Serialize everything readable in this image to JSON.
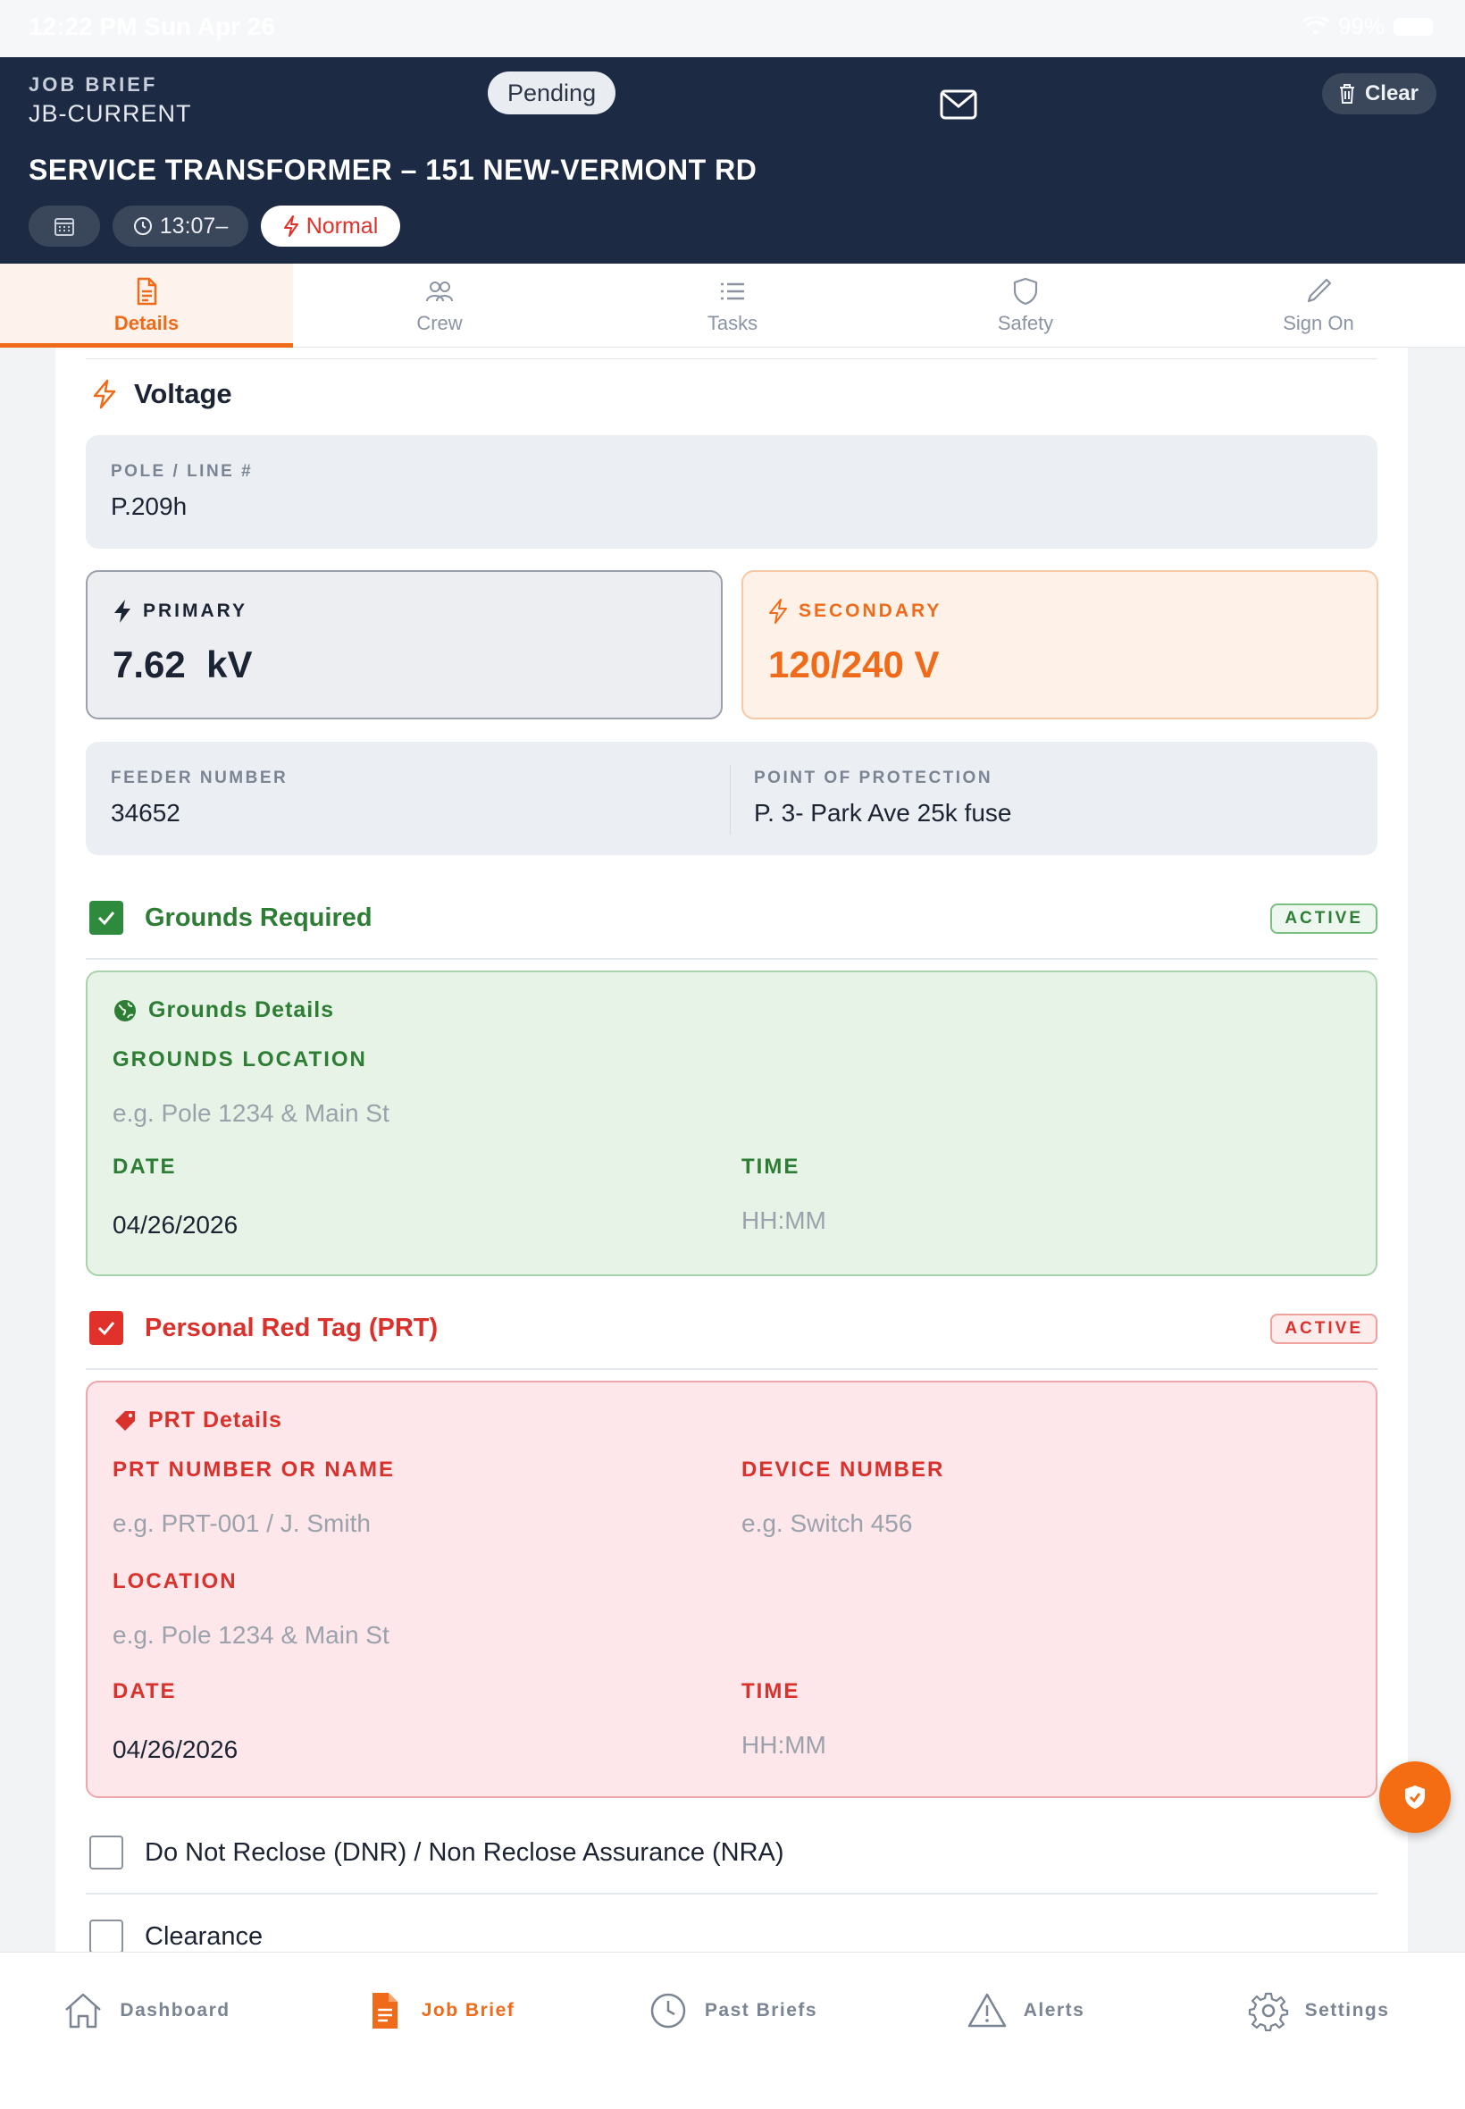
{
  "status_bar": {
    "time": "12:22 PM  Sun Apr 26",
    "battery": "99%"
  },
  "header": {
    "label": "JOB BRIEF",
    "job_id": "JB-CURRENT",
    "status": "Pending",
    "clear_label": "Clear",
    "title": "SERVICE TRANSFORMER – 151 NEW-VERMONT RD",
    "time_chip": "13:07–",
    "priority": "Normal"
  },
  "tabs": [
    {
      "label": "Details",
      "icon": "document-icon",
      "active": true
    },
    {
      "label": "Crew",
      "icon": "people-icon",
      "active": false
    },
    {
      "label": "Tasks",
      "icon": "list-icon",
      "active": false
    },
    {
      "label": "Safety",
      "icon": "shield-icon",
      "active": false
    },
    {
      "label": "Sign On",
      "icon": "pencil-icon",
      "active": false
    }
  ],
  "voltage": {
    "section_title": "Voltage",
    "pole_label": "POLE / LINE #",
    "pole_value": "P.209h",
    "primary_label": "PRIMARY",
    "primary_value": "7.62  kV",
    "secondary_label": "SECONDARY",
    "secondary_value": "120/240 V",
    "feeder_label": "FEEDER NUMBER",
    "feeder_value": "34652",
    "protection_label": "POINT OF PROTECTION",
    "protection_value": "P. 3- Park Ave 25k fuse"
  },
  "grounds": {
    "check_label": "Grounds Required",
    "checked": true,
    "badge": "ACTIVE",
    "details_title": "Grounds Details",
    "location_label": "GROUNDS LOCATION",
    "location_placeholder": "e.g. Pole 1234 & Main St",
    "date_label": "DATE",
    "date_value": "04/26/2026",
    "time_label": "TIME",
    "time_placeholder": "HH:MM"
  },
  "prt": {
    "check_label": "Personal Red Tag (PRT)",
    "checked": true,
    "badge": "ACTIVE",
    "details_title": "PRT Details",
    "number_label": "PRT NUMBER OR NAME",
    "number_placeholder": "e.g. PRT-001 / J. Smith",
    "device_label": "DEVICE NUMBER",
    "device_placeholder": "e.g. Switch 456",
    "location_label": "LOCATION",
    "location_placeholder": "e.g. Pole 1234 & Main St",
    "date_label": "DATE",
    "date_value": "04/26/2026",
    "time_label": "TIME",
    "time_placeholder": "HH:MM"
  },
  "dnr": {
    "check_label": "Do Not Reclose (DNR) / Non Reclose Assurance (NRA)",
    "checked": false
  },
  "clearance": {
    "check_label": "Clearance",
    "checked": false
  },
  "bottom_nav": [
    {
      "label": "Dashboard",
      "icon": "home-icon",
      "active": false
    },
    {
      "label": "Job Brief",
      "icon": "job-brief-icon",
      "active": true
    },
    {
      "label": "Past Briefs",
      "icon": "clock-icon",
      "active": false
    },
    {
      "label": "Alerts",
      "icon": "warning-icon",
      "active": false
    },
    {
      "label": "Settings",
      "icon": "gear-icon",
      "active": false
    }
  ],
  "colors": {
    "header_bg": "#1c2a44",
    "accent": "#f06b19",
    "green": "#2e7d35",
    "red": "#d9312b"
  }
}
